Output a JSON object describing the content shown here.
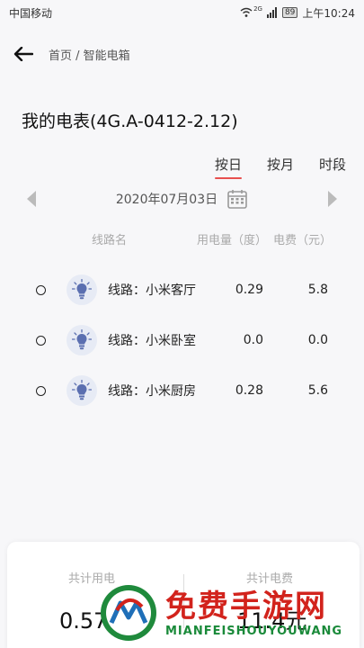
{
  "status_bar": {
    "carrier": "中国移动",
    "network": "2G",
    "battery": "89",
    "time": "上午10:24"
  },
  "nav": {
    "breadcrumb": "首页 / 智能电箱"
  },
  "title": "我的电表(4G.A-0412-2.12)",
  "tabs": [
    {
      "label": "按日",
      "active": true
    },
    {
      "label": "按月",
      "active": false
    },
    {
      "label": "时段",
      "active": false
    }
  ],
  "date": "2020年07月03日",
  "table": {
    "headers": [
      "线路名",
      "用电量（度）",
      "电费（元）"
    ],
    "rows": [
      {
        "name": "线路：小米客厅",
        "usage": "0.29",
        "fee": "5.8"
      },
      {
        "name": "线路：小米卧室",
        "usage": "0.0",
        "fee": "0.0"
      },
      {
        "name": "线路：小米厨房",
        "usage": "0.28",
        "fee": "5.6"
      }
    ]
  },
  "summary": {
    "total_usage_label": "共计用电",
    "total_usage_value": "0.57度",
    "total_fee_label": "共计电费",
    "total_fee_value": "11.4元"
  },
  "watermark": {
    "text_big": "免费手游网",
    "text_small": "MIANFEISHOUYOUWANG"
  },
  "colors": {
    "accent": "#e8504f",
    "bulb_bg": "#e7ebf5",
    "bulb": "#5b6fb0"
  }
}
